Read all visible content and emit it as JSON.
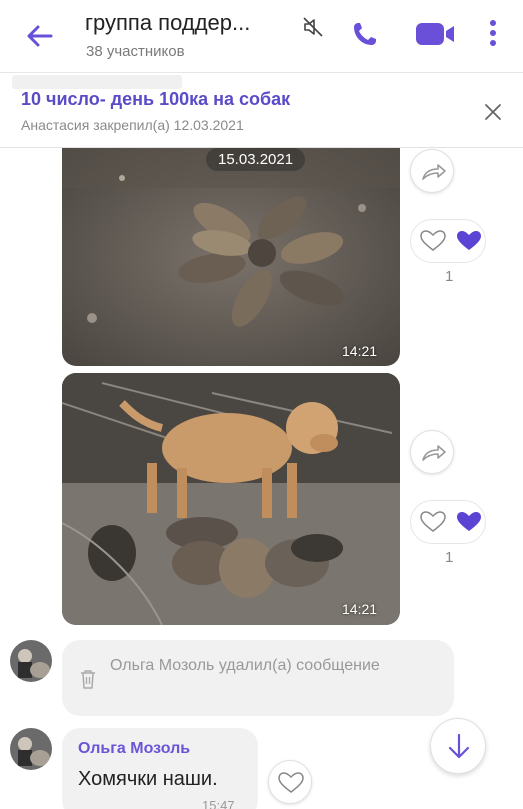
{
  "header": {
    "title": "группа поддер...",
    "subtitle": "38 участников",
    "accent_color": "#6a4fd8"
  },
  "pinned": {
    "title": "10 число- день 100ка на собак",
    "subtitle": "Анастасия закрепил(а) 12.03.2021"
  },
  "messages": [
    {
      "type": "photo",
      "date_label": "15.03.2021",
      "time": "14:21",
      "likes": "1"
    },
    {
      "type": "photo",
      "time": "14:21",
      "likes": "1"
    },
    {
      "type": "deleted",
      "text": "Ольга Мозоль удалил(а) сообщение"
    },
    {
      "type": "text",
      "author": "Ольга Мозоль",
      "text": "Хомячки наши.",
      "time": "15:47"
    }
  ]
}
